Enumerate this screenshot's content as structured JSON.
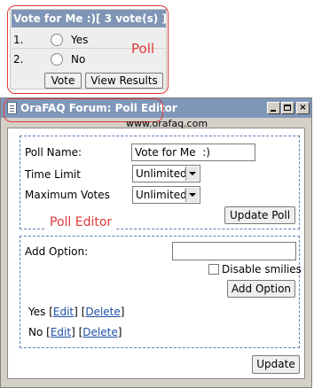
{
  "poll": {
    "title": "Vote for Me :)[ 3 vote(s) ]",
    "options": [
      {
        "number": "1.",
        "label": "Yes"
      },
      {
        "number": "2.",
        "label": "No"
      }
    ],
    "vote_label": "Vote",
    "view_results_label": "View Results",
    "callout": "Poll"
  },
  "window": {
    "title": "OraFAQ Forum: Poll Editor",
    "url": "www.orafaq.com",
    "controls": {
      "close": "×"
    }
  },
  "editor": {
    "poll_name_label": "Poll Name:",
    "poll_name_value": "Vote for Me  :)",
    "time_limit_label": "Time Limit",
    "time_limit_value": "Unlimited",
    "max_votes_label": "Maximum Votes",
    "max_votes_value": "Unlimited",
    "update_poll_label": "Update Poll",
    "callout": "Poll Editor",
    "add_option_label": "Add Option:",
    "add_option_value": "",
    "disable_smilies_label": "Disable smilies",
    "add_option_button": "Add Option",
    "options": [
      {
        "label": "Yes",
        "edit": "Edit",
        "delete": "Delete"
      },
      {
        "label": "No",
        "edit": "Edit",
        "delete": "Delete"
      }
    ],
    "update_label": "Update"
  },
  "colors": {
    "titlebar": "#7f97b9",
    "poll_header": "#7f95b5",
    "callout_red": "#e03838",
    "dashed_border": "#5b7fb4",
    "link": "#1f4fa6"
  }
}
